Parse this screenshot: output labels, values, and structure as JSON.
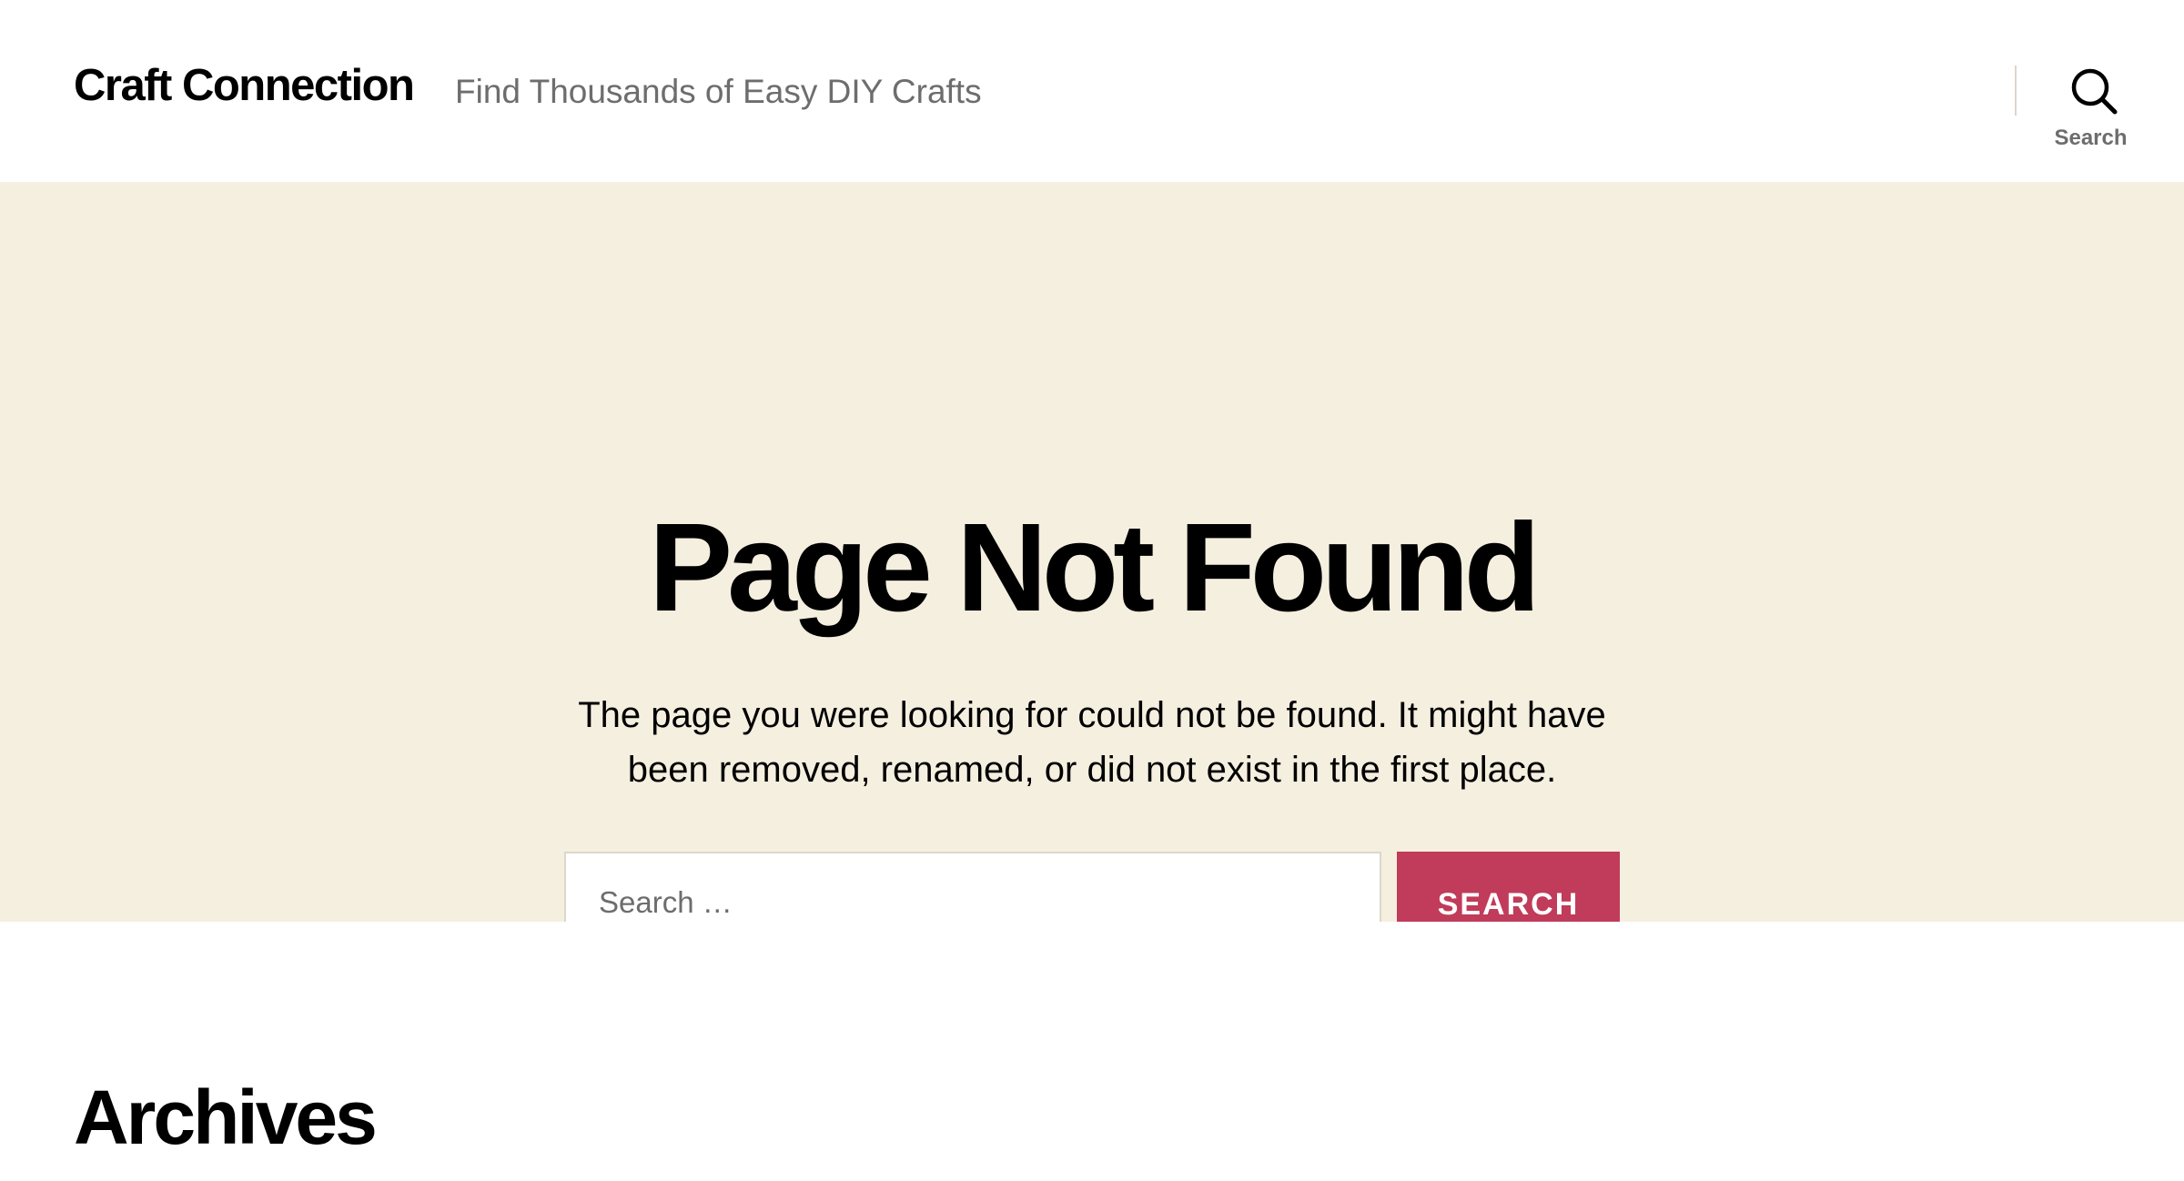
{
  "site": {
    "title": "Craft Connection",
    "tagline": "Find Thousands of Easy DIY Crafts"
  },
  "header": {
    "search_toggle_label": "Search",
    "search_icon": "search-icon"
  },
  "hero": {
    "title": "Page Not Found",
    "message": "The page you were looking for could not be found. It might have been removed, renamed, or did not exist in the first place."
  },
  "search_form": {
    "placeholder": "Search …",
    "value": "",
    "submit_label": "SEARCH"
  },
  "archives": {
    "heading": "Archives"
  },
  "colors": {
    "accent": "#c13b5a",
    "hero_background": "#f5efe0",
    "border": "#dcd7ca",
    "secondary_text": "#6d6d6d"
  }
}
